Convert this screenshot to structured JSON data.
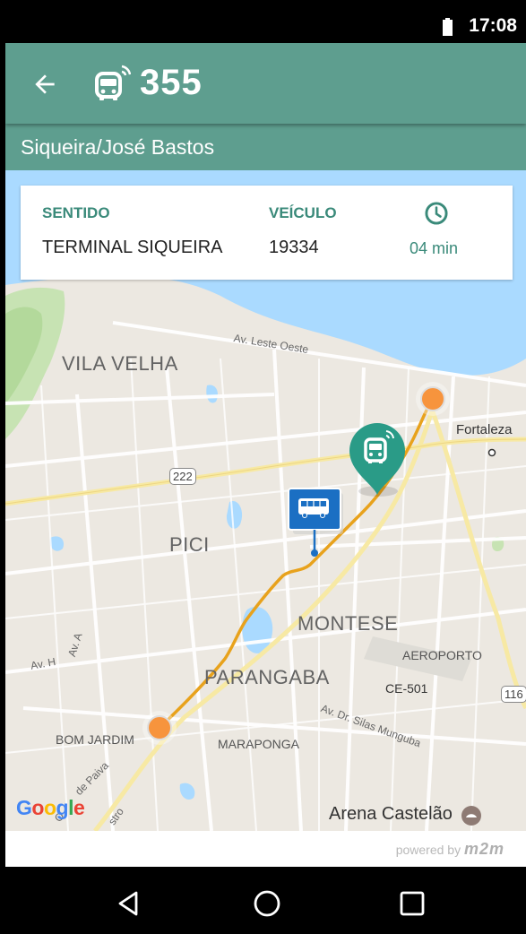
{
  "status_bar": {
    "time": "17:08"
  },
  "header": {
    "route_number": "355",
    "route_name": "Siqueira/José Bastos"
  },
  "info_card": {
    "direction_label": "SENTIDO",
    "direction_value": "TERMINAL SIQUEIRA",
    "vehicle_label": "VEÍCULO",
    "vehicle_value": "19334",
    "eta_value": "04 min"
  },
  "map": {
    "labels": {
      "vila_velha": "VILA VELHA",
      "pici": "PICI",
      "montese": "MONTESE",
      "parangaba": "PARANGABA",
      "bom_jardim": "BOM JARDIM",
      "maraponga": "MARAPONGA",
      "aeroporto": "AEROPORTO",
      "fortaleza": "Fortaleza",
      "arena": "Arena Castelão",
      "av_leste_oeste": "Av. Leste Oeste",
      "av_dr_silas": "Av. Dr. Silas Munguba",
      "av_h": "Av. H",
      "av_a": "Av. A",
      "de_paiva": "de Paiva",
      "o_text": "O",
      "stro": "stro",
      "ce501": "CE-501",
      "br222": "222",
      "br116": "116"
    },
    "google_letters": [
      "G",
      "o",
      "o",
      "g",
      "l",
      "e"
    ]
  },
  "footer": {
    "powered_by": "powered by",
    "brand": "m2m"
  },
  "colors": {
    "primary": "#5e9e8f",
    "accent_text": "#3a8a7a",
    "route_line": "#e8a21c",
    "endpoint": "#f7943d",
    "bus_marker": "#2a9b87",
    "stop_marker": "#1b6fc3",
    "water": "#aadaff"
  },
  "icons": [
    "battery-icon",
    "back-arrow-icon",
    "bus-icon",
    "clock-icon",
    "bus-marker-icon",
    "bus-stop-icon",
    "arena-icon",
    "nav-back-icon",
    "nav-home-icon",
    "nav-recents-icon"
  ]
}
